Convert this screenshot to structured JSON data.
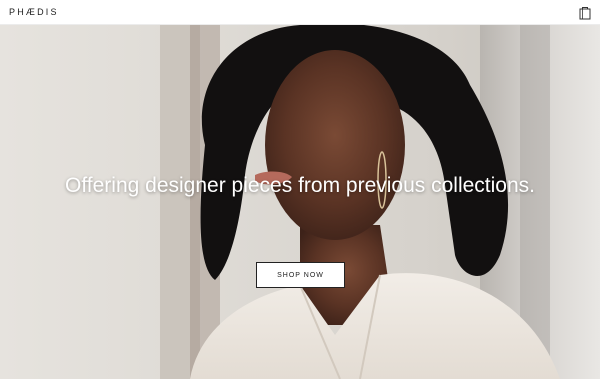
{
  "header": {
    "logo_text": "PHÆDIS",
    "bag_icon": "shopping-bag-icon"
  },
  "hero": {
    "headline": "Offering designer pieces from previous collections.",
    "cta_label": "SHOP NOW",
    "image_description_icon": "hero-photo"
  },
  "colors": {
    "header_bg": "#ffffff",
    "text_dark": "#1c1c1c",
    "button_border": "#222222",
    "headline_text": "#ffffff"
  }
}
